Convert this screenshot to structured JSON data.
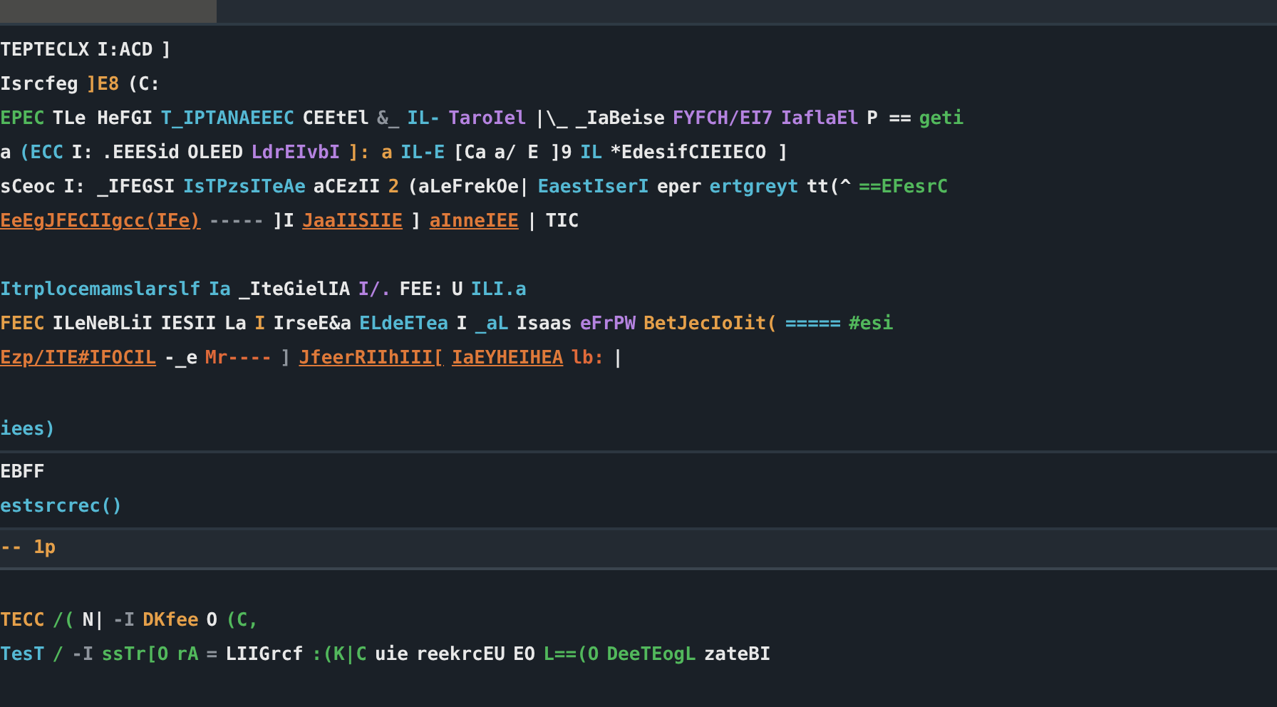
{
  "sections": [
    {
      "kind": "code",
      "lines": [
        {
          "tokens": [
            {
              "text": "TEPTECLX",
              "kind": "plain"
            },
            {
              "text": "I:ACD",
              "kind": "plain"
            },
            {
              "text": "]",
              "kind": "plain"
            }
          ]
        },
        {
          "tokens": [
            {
              "text": "Isrcfeg",
              "kind": "plain"
            },
            {
              "text": "]E8",
              "kind": "number"
            },
            {
              "text": "(C:",
              "kind": "plain"
            }
          ]
        },
        {
          "tokens": [
            {
              "text": "EPEC",
              "kind": "green"
            },
            {
              "text": "TLe HeFGI",
              "kind": "plain"
            },
            {
              "text": "T_IPTANAEEEC",
              "kind": "func"
            },
            {
              "text": "CEEtEl",
              "kind": "plain"
            },
            {
              "text": "&_",
              "kind": "dim"
            },
            {
              "text": "IL-",
              "kind": "func"
            },
            {
              "text": "TaroIel",
              "kind": "keyword"
            },
            {
              "text": "|\\_",
              "kind": "plain"
            },
            {
              "text": "_IaBeise",
              "kind": "plain"
            },
            {
              "text": "FYFCH/EI7",
              "kind": "keyword"
            },
            {
              "text": "IaflaEl",
              "kind": "keyword"
            },
            {
              "text": "P ==",
              "kind": "plain"
            },
            {
              "text": "geti",
              "kind": "green"
            }
          ]
        },
        {
          "tokens": [
            {
              "text": "a",
              "kind": "plain"
            },
            {
              "text": "(ECC",
              "kind": "func"
            },
            {
              "text": "I:",
              "kind": "plain"
            },
            {
              "text": ".EEESid",
              "kind": "plain"
            },
            {
              "text": "OLEED",
              "kind": "plain"
            },
            {
              "text": "LdrEIvbI",
              "kind": "keyword"
            },
            {
              "text": "]: a",
              "kind": "number"
            },
            {
              "text": "IL-E",
              "kind": "func"
            },
            {
              "text": "[Ca",
              "kind": "plain"
            },
            {
              "text": "a/ E ]9",
              "kind": "plain"
            },
            {
              "text": "IL",
              "kind": "func"
            },
            {
              "text": "*EdesifCIEIECO ]",
              "kind": "plain"
            }
          ]
        },
        {
          "tokens": [
            {
              "text": "sCeoc",
              "kind": "plain"
            },
            {
              "text": "I: _IFEGSI",
              "kind": "plain"
            },
            {
              "text": "IsTPzsITeAe",
              "kind": "func"
            },
            {
              "text": "aCEzII",
              "kind": "plain"
            },
            {
              "text": "2",
              "kind": "number"
            },
            {
              "text": "(aLeFrekOe|",
              "kind": "plain"
            },
            {
              "text": "EaestIserI",
              "kind": "func"
            },
            {
              "text": "eper",
              "kind": "plain"
            },
            {
              "text": "ertgreyt",
              "kind": "func"
            },
            {
              "text": "tt(^",
              "kind": "plain"
            },
            {
              "text": "==EFesrC",
              "kind": "green"
            }
          ]
        },
        {
          "tokens": [
            {
              "text": "EeEgJFECIIgcc(IFe)",
              "kind": "link"
            },
            {
              "text": "-----",
              "kind": "dim"
            },
            {
              "text": "]I",
              "kind": "plain"
            },
            {
              "text": "JaaIISIIE",
              "kind": "link"
            },
            {
              "text": "]",
              "kind": "plain"
            },
            {
              "text": "aInneIEE",
              "kind": "link"
            },
            {
              "text": "|",
              "kind": "plain"
            },
            {
              "text": "TIC",
              "kind": "plain"
            }
          ]
        }
      ]
    },
    {
      "kind": "code",
      "lines": [
        {
          "tokens": [
            {
              "text": "Itrplocemamslarslf",
              "kind": "func"
            },
            {
              "text": "Ia",
              "kind": "func"
            },
            {
              "text": "_IteGielIA",
              "kind": "plain"
            },
            {
              "text": "I/.",
              "kind": "keyword"
            },
            {
              "text": "FEE:",
              "kind": "plain"
            },
            {
              "text": "U",
              "kind": "plain"
            },
            {
              "text": "ILI.a",
              "kind": "func"
            }
          ]
        },
        {
          "tokens": [
            {
              "text": "FEEC",
              "kind": "number"
            },
            {
              "text": "ILeNeBLiI",
              "kind": "plain"
            },
            {
              "text": "IESII",
              "kind": "plain"
            },
            {
              "text": "La",
              "kind": "plain"
            },
            {
              "text": "I",
              "kind": "number"
            },
            {
              "text": "IrseE&a",
              "kind": "plain"
            },
            {
              "text": "ELdeETea",
              "kind": "func"
            },
            {
              "text": "I",
              "kind": "plain"
            },
            {
              "text": "_aL",
              "kind": "func"
            },
            {
              "text": "Isaas",
              "kind": "plain"
            },
            {
              "text": "eFrPW",
              "kind": "keyword"
            },
            {
              "text": "BetJecIoIit(",
              "kind": "number"
            },
            {
              "text": "=====",
              "kind": "func"
            },
            {
              "text": "#esi",
              "kind": "green"
            }
          ]
        },
        {
          "tokens": [
            {
              "text": "Ezp/ITE#IFOCIL",
              "kind": "link"
            },
            {
              "text": "-_e",
              "kind": "plain"
            },
            {
              "text": "Mr----",
              "kind": "string"
            },
            {
              "text": "]",
              "kind": "dim"
            },
            {
              "text": "JfeerRIIhIII[",
              "kind": "link"
            },
            {
              "text": "IaEYHEIHEA",
              "kind": "link"
            },
            {
              "text": "lb:",
              "kind": "string"
            },
            {
              "text": "|",
              "kind": "plain"
            }
          ]
        }
      ]
    },
    {
      "kind": "row",
      "lines": [
        {
          "tokens": [
            {
              "text": "iees)",
              "kind": "func"
            }
          ]
        }
      ]
    },
    {
      "kind": "row",
      "lines": [
        {
          "tokens": [
            {
              "text": "EBFF",
              "kind": "plain"
            }
          ]
        },
        {
          "tokens": [
            {
              "text": "estsrcrec()",
              "kind": "func"
            }
          ]
        }
      ]
    },
    {
      "kind": "band",
      "lines": [
        {
          "tokens": [
            {
              "text": "-- 1p",
              "kind": "number"
            }
          ]
        }
      ]
    },
    {
      "kind": "code",
      "lines": [
        {
          "tokens": [
            {
              "text": "TECC",
              "kind": "number"
            },
            {
              "text": "/(",
              "kind": "green"
            },
            {
              "text": "N|",
              "kind": "plain"
            },
            {
              "text": "-I",
              "kind": "dim"
            },
            {
              "text": "DKfee",
              "kind": "number"
            },
            {
              "text": "O",
              "kind": "plain"
            },
            {
              "text": "(C,",
              "kind": "green"
            }
          ]
        },
        {
          "tokens": [
            {
              "text": "TesT",
              "kind": "func"
            },
            {
              "text": "/",
              "kind": "green"
            },
            {
              "text": "-I",
              "kind": "dim"
            },
            {
              "text": "ssTr[O",
              "kind": "green"
            },
            {
              "text": "rA",
              "kind": "green"
            },
            {
              "text": "=",
              "kind": "dim"
            },
            {
              "text": "LIIGrcf",
              "kind": "plain"
            },
            {
              "text": ":(K|C",
              "kind": "green"
            },
            {
              "text": "uie",
              "kind": "plain"
            },
            {
              "text": "reekrcEU",
              "kind": "plain"
            },
            {
              "text": "EO",
              "kind": "plain"
            },
            {
              "text": "L==(O",
              "kind": "green"
            },
            {
              "text": "DeeTEogL",
              "kind": "green"
            },
            {
              "text": "zateBI",
              "kind": "plain"
            }
          ]
        }
      ]
    }
  ]
}
